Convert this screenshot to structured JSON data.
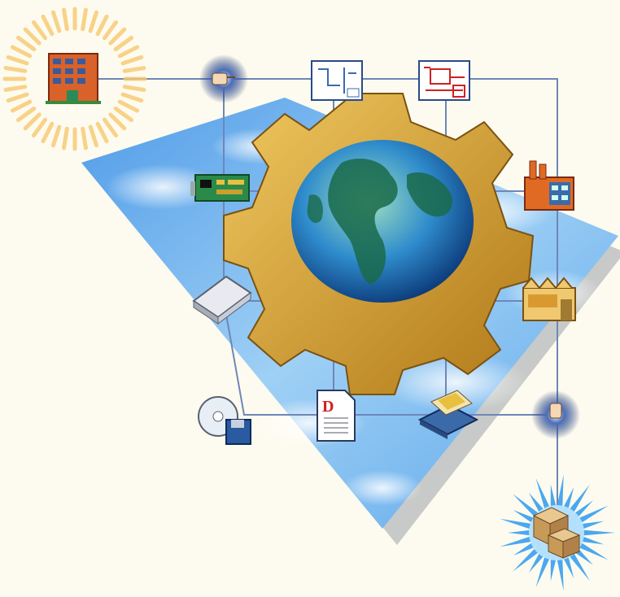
{
  "colors": {
    "background": "#fdfbef",
    "sky": "#7ab8ec",
    "gear": "#d8a83a",
    "line": "#6e87b8"
  },
  "icons": [
    "office-building-icon",
    "network-hand-icon",
    "schematic-document-icon",
    "blueprint-document-icon",
    "circuit-board-icon",
    "factory-icon",
    "warehouse-icon",
    "scanner-device-icon",
    "cd-floppy-icon",
    "pdf-document-icon",
    "books-icon",
    "package-boxes-icon"
  ]
}
